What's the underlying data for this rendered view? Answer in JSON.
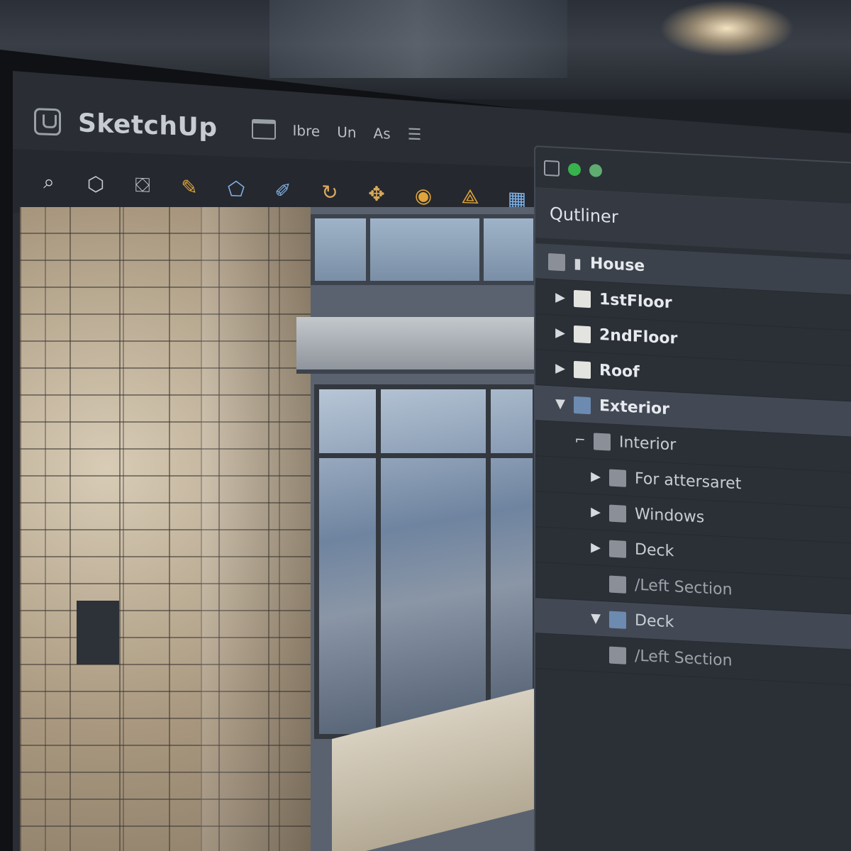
{
  "app": {
    "title": "SketchUp",
    "menu": [
      "Ibre",
      "Un",
      "As"
    ]
  },
  "toolbar": {
    "tools": [
      "search-icon",
      "component-icon",
      "paint-bucket-icon",
      "pencil-icon",
      "shape-icon",
      "brush-icon",
      "rotate-icon",
      "move-icon",
      "material-icon",
      "scale-icon",
      "layer-icon"
    ]
  },
  "outliner": {
    "title": "Qutliner",
    "rows": [
      {
        "label": "House",
        "kind": "root"
      },
      {
        "label": "1stFloor",
        "kind": "item"
      },
      {
        "label": "2ndFloor",
        "kind": "item"
      },
      {
        "label": "Roof",
        "kind": "item"
      },
      {
        "label": "Exterior",
        "kind": "expanded"
      },
      {
        "label": "Interior",
        "kind": "sub"
      },
      {
        "label": "For attersaret",
        "kind": "sub"
      },
      {
        "label": "Windows",
        "kind": "sub"
      },
      {
        "label": "Deck",
        "kind": "sub"
      },
      {
        "label": "/Left Section",
        "kind": "faded"
      },
      {
        "label": "Deck",
        "kind": "selected"
      },
      {
        "label": "/Left Section",
        "kind": "faded"
      }
    ]
  }
}
